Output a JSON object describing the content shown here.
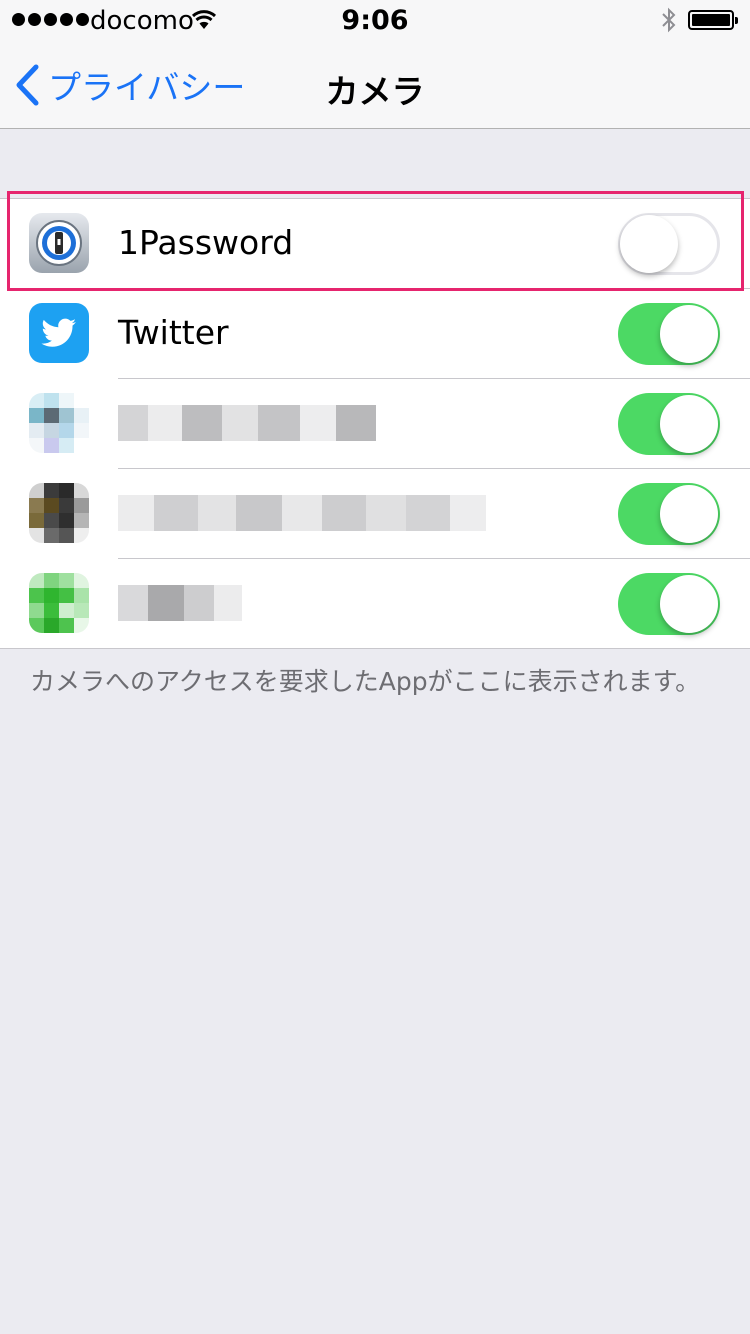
{
  "status_bar": {
    "carrier": "docomo",
    "time": "9:06",
    "signal_bars": 5,
    "icons": [
      "wifi-icon",
      "bluetooth-icon",
      "battery-icon"
    ]
  },
  "nav": {
    "back_label": "プライバシー",
    "title": "カメラ"
  },
  "apps": [
    {
      "name": "1Password",
      "enabled": false,
      "icon": "1password-icon"
    },
    {
      "name": "Twitter",
      "enabled": true,
      "icon": "twitter-icon"
    },
    {
      "name": "",
      "enabled": true,
      "icon": "blurred-app-icon"
    },
    {
      "name": "",
      "enabled": true,
      "icon": "blurred-app-icon"
    },
    {
      "name": "",
      "enabled": true,
      "icon": "blurred-app-icon"
    }
  ],
  "footer": "カメラへのアクセスを要求したAppがここに表示されます。",
  "colors": {
    "accent": "#1a73f6",
    "toggle_on": "#4cd964",
    "highlight": "#e6256e",
    "background": "#ebebf1"
  }
}
